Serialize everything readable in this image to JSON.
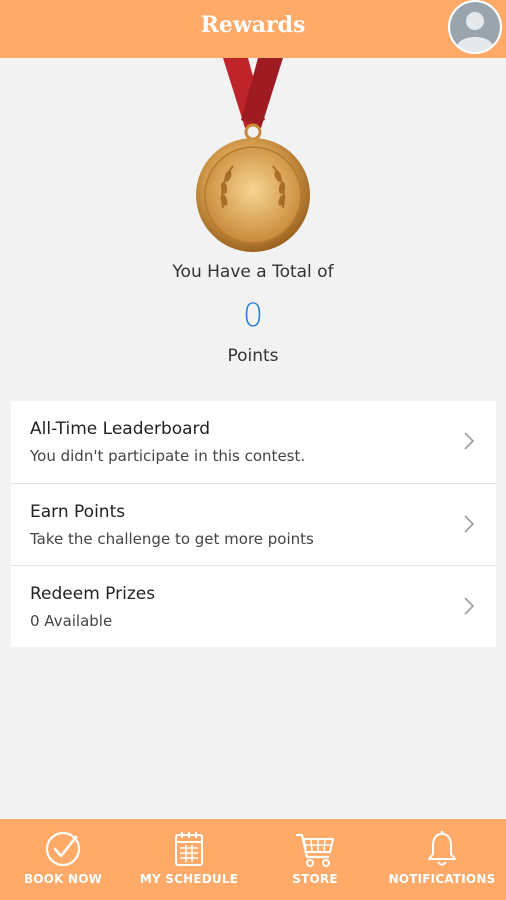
{
  "header": {
    "title": "Rewards"
  },
  "summary": {
    "total_label": "You Have a Total of",
    "points_value": "0",
    "points_label": "Points"
  },
  "list": [
    {
      "title": "All-Time Leaderboard",
      "subtitle": "You didn't participate in this contest."
    },
    {
      "title": "Earn Points",
      "subtitle": "Take the challenge to get more points"
    },
    {
      "title": "Redeem Prizes",
      "subtitle": "0 Available"
    }
  ],
  "tabs": [
    {
      "label": "BOOK NOW",
      "icon": "check-circle-icon"
    },
    {
      "label": "MY SCHEDULE",
      "icon": "calendar-icon"
    },
    {
      "label": "STORE",
      "icon": "cart-icon"
    },
    {
      "label": "NOTIFICATIONS",
      "icon": "bell-icon"
    }
  ],
  "colors": {
    "accent": "#ffaa68",
    "points": "#2b7bd6",
    "background": "#f2f2f2"
  }
}
